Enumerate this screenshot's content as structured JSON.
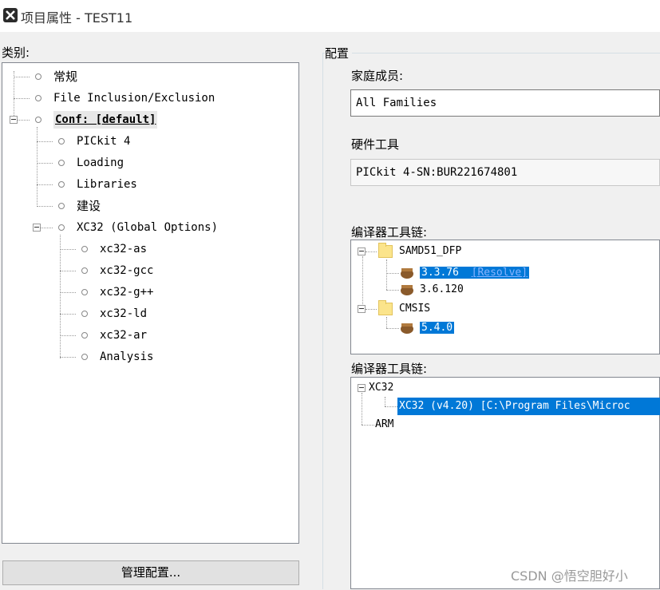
{
  "window": {
    "title": "项目属性 - TEST11",
    "icon": "app-x-icon"
  },
  "categories": {
    "label": "类别:",
    "items": [
      {
        "label": "常规"
      },
      {
        "label": "File Inclusion/Exclusion"
      },
      {
        "label": "Conf: [default]"
      },
      {
        "label": "PICkit 4"
      },
      {
        "label": "Loading"
      },
      {
        "label": "Libraries"
      },
      {
        "label": "建设"
      },
      {
        "label": "XC32 (Global Options)"
      },
      {
        "label": "xc32-as"
      },
      {
        "label": "xc32-gcc"
      },
      {
        "label": "xc32-g++"
      },
      {
        "label": "xc32-ld"
      },
      {
        "label": "xc32-ar"
      },
      {
        "label": "Analysis"
      }
    ]
  },
  "manage_button": "管理配置...",
  "config": {
    "group_label": "配置",
    "family_label": "家庭成员:",
    "family_value": "All Families",
    "hardware_label": "硬件工具",
    "hardware_value": "PICkit 4-SN:BUR221674801",
    "toolchain1_label": "编译器工具链:",
    "toolchain1": {
      "pack1": "SAMD51_DFP",
      "pack1_v1": "3.3.76",
      "pack1_v1_link": "[Resolve]",
      "pack1_v2": "3.6.120",
      "pack2": "CMSIS",
      "pack2_v1": "5.4.0"
    },
    "toolchain2_label": "编译器工具链:",
    "toolchain2": {
      "group1": "XC32",
      "group1_item": "XC32 (v4.20) [C:\\Program Files\\Microc",
      "group2": "ARM"
    }
  },
  "watermark": "CSDN @悟空胆好小"
}
